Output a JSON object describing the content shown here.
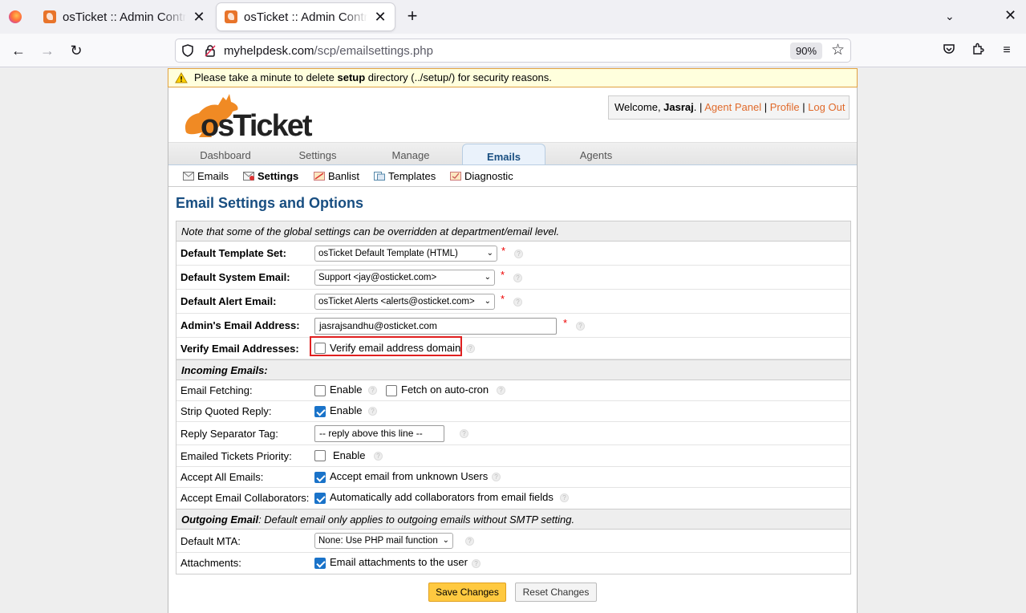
{
  "browser": {
    "tabs": [
      {
        "title": "osTicket :: Admin Control Panel",
        "active": false
      },
      {
        "title": "osTicket :: Admin Control Panel",
        "active": true
      }
    ],
    "url_domain": "myhelpdesk.com",
    "url_path": "/scp/emailsettings.php",
    "zoom": "90%"
  },
  "warning": {
    "pre": "Please take a minute to delete ",
    "bold": "setup",
    "post": " directory (../setup/) for security reasons."
  },
  "header": {
    "logo_text": "osTicket",
    "welcome_prefix": "Welcome, ",
    "user": "Jasraj",
    "sep1": ". | ",
    "agent_panel": "Agent Panel",
    "sep2": " | ",
    "profile": "Profile",
    "sep3": " | ",
    "logout": "Log Out"
  },
  "mainnav": {
    "dashboard": "Dashboard",
    "settings": "Settings",
    "manage": "Manage",
    "emails": "Emails",
    "agents": "Agents"
  },
  "subnav": {
    "emails": "Emails",
    "settings": "Settings",
    "banlist": "Banlist",
    "templates": "Templates",
    "diagnostic": "Diagnostic"
  },
  "page_title": "Email Settings and Options",
  "form": {
    "note": "Note that some of the global settings can be overridden at department/email level.",
    "default_template_label": "Default Template Set:",
    "default_template_value": "osTicket Default Template (HTML)",
    "default_system_email_label": "Default System Email:",
    "default_system_email_value": "Support <jay@osticket.com>",
    "default_alert_email_label": "Default Alert Email:",
    "default_alert_email_value": "osTicket Alerts <alerts@osticket.com>",
    "admin_email_label": "Admin's Email Address:",
    "admin_email_value": "jasrajsandhu@osticket.com",
    "verify_label": "Verify Email Addresses:",
    "verify_option": "Verify email address domain",
    "incoming_header": "Incoming Emails:",
    "fetching_label": "Email Fetching:",
    "fetching_enable": "Enable",
    "fetching_autocron": "Fetch on auto-cron",
    "strip_label": "Strip Quoted Reply:",
    "strip_enable": "Enable",
    "separator_label": "Reply Separator Tag:",
    "separator_value": "-- reply above this line --",
    "priority_label": "Emailed Tickets Priority:",
    "priority_enable": "Enable",
    "accept_all_label": "Accept All Emails:",
    "accept_all_option": "Accept email from unknown Users",
    "collab_label": "Accept Email Collaborators:",
    "collab_option": "Automatically add collaborators from email fields",
    "outgoing_header_bold": "Outgoing Email",
    "outgoing_header_rest": ": Default email only applies to outgoing emails without SMTP setting.",
    "mta_label": "Default MTA:",
    "mta_value": "None: Use PHP mail function",
    "attachments_label": "Attachments:",
    "attachments_option": "Email attachments to the user",
    "required_mark": "*",
    "help_mark": "?"
  },
  "buttons": {
    "save": "Save Changes",
    "reset": "Reset Changes"
  },
  "checkbox_state": {
    "verify": false,
    "fetching_enable": false,
    "fetching_autocron": false,
    "strip": true,
    "priority": false,
    "accept_all": true,
    "collab": true,
    "attachments": true
  }
}
